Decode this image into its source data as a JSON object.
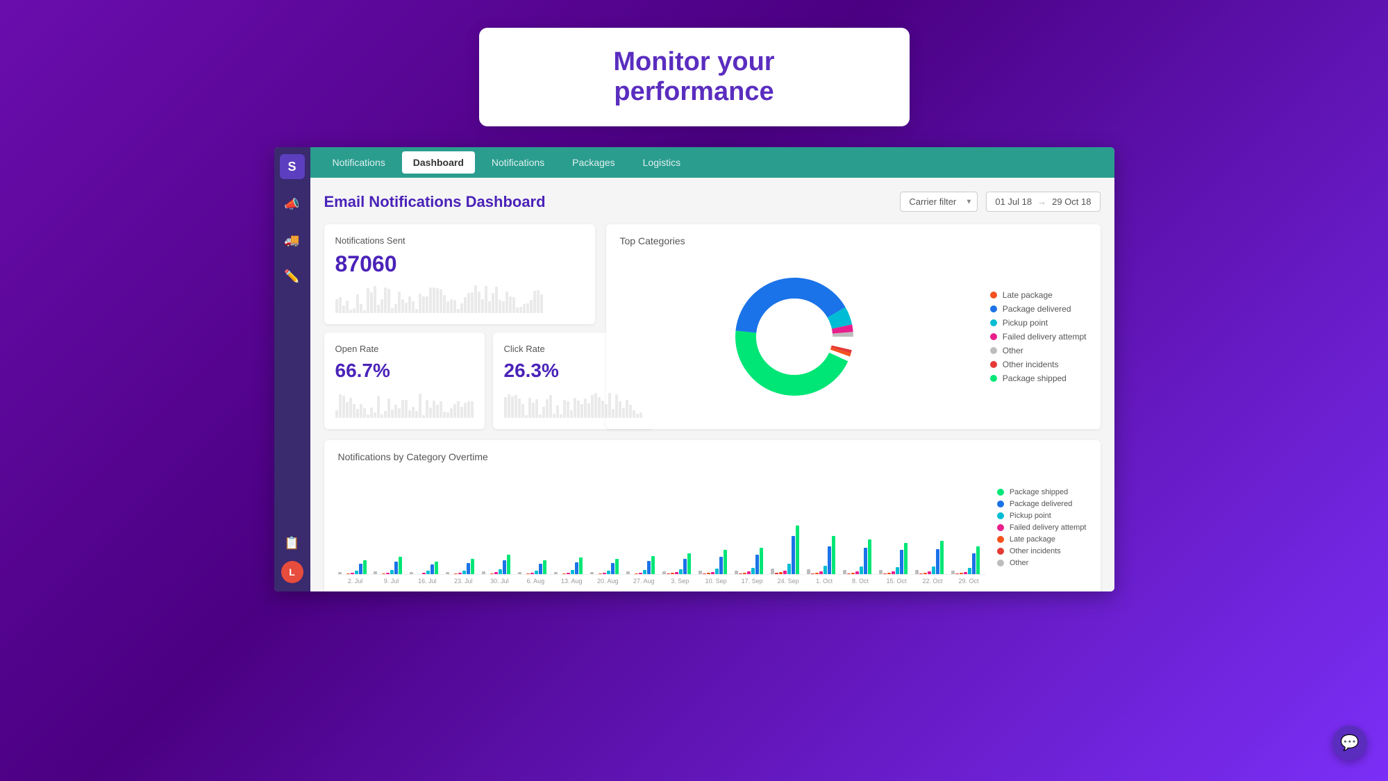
{
  "top_banner": {
    "title": "Monitor your performance"
  },
  "sidebar": {
    "logo": "S",
    "icons": [
      "📣",
      "🚚",
      "✏️"
    ],
    "bottom_icons": [
      "📋"
    ],
    "avatar": "L"
  },
  "nav": {
    "brand": "Notifications",
    "tabs": [
      {
        "label": "Dashboard",
        "active": true
      },
      {
        "label": "Notifications",
        "active": false
      },
      {
        "label": "Packages",
        "active": false
      },
      {
        "label": "Logistics",
        "active": false
      }
    ]
  },
  "dashboard": {
    "title": "Email Notifications Dashboard",
    "carrier_filter": {
      "label": "Carrier filter",
      "placeholder": "Carrier filter"
    },
    "date_range": {
      "start": "01 Jul 18",
      "end": "29 Oct 18",
      "arrow": "→"
    },
    "notifications_sent": {
      "label": "Notifications Sent",
      "value": "87060"
    },
    "open_rate": {
      "label": "Open Rate",
      "value": "66.7%"
    },
    "click_rate": {
      "label": "Click Rate",
      "value": "26.3%"
    },
    "top_categories": {
      "title": "Top Categories",
      "legend": [
        {
          "label": "Late package",
          "color": "#f4511e"
        },
        {
          "label": "Package delivered",
          "color": "#1a73e8"
        },
        {
          "label": "Pickup point",
          "color": "#00bcd4"
        },
        {
          "label": "Failed delivery attempt",
          "color": "#e91e8c"
        },
        {
          "label": "Other",
          "color": "#bdbdbd"
        },
        {
          "label": "Other incidents",
          "color": "#e53935"
        },
        {
          "label": "Package shipped",
          "color": "#00e676"
        }
      ]
    },
    "chart": {
      "title": "Notifications by Category Overtime",
      "x_labels": [
        "2. Jul",
        "9. Jul",
        "16. Jul",
        "23. Jul",
        "30. Jul",
        "6. Aug",
        "13. Aug",
        "20. Aug",
        "27. Aug",
        "3. Sep",
        "10. Sep",
        "17. Sep",
        "24. Sep",
        "1. Oct",
        "8. Oct",
        "15. Oct",
        "22. Oct",
        "29. Oct"
      ],
      "legend": [
        {
          "label": "Package shipped",
          "color": "#00e676"
        },
        {
          "label": "Package delivered",
          "color": "#1a73e8"
        },
        {
          "label": "Pickup point",
          "color": "#00bcd4"
        },
        {
          "label": "Failed delivery attempt",
          "color": "#e91e8c"
        },
        {
          "label": "Late package",
          "color": "#f4511e"
        },
        {
          "label": "Other incidents",
          "color": "#e53935"
        },
        {
          "label": "Other",
          "color": "#bdbdbd"
        }
      ]
    }
  },
  "chat_button": {
    "icon": "💬"
  }
}
